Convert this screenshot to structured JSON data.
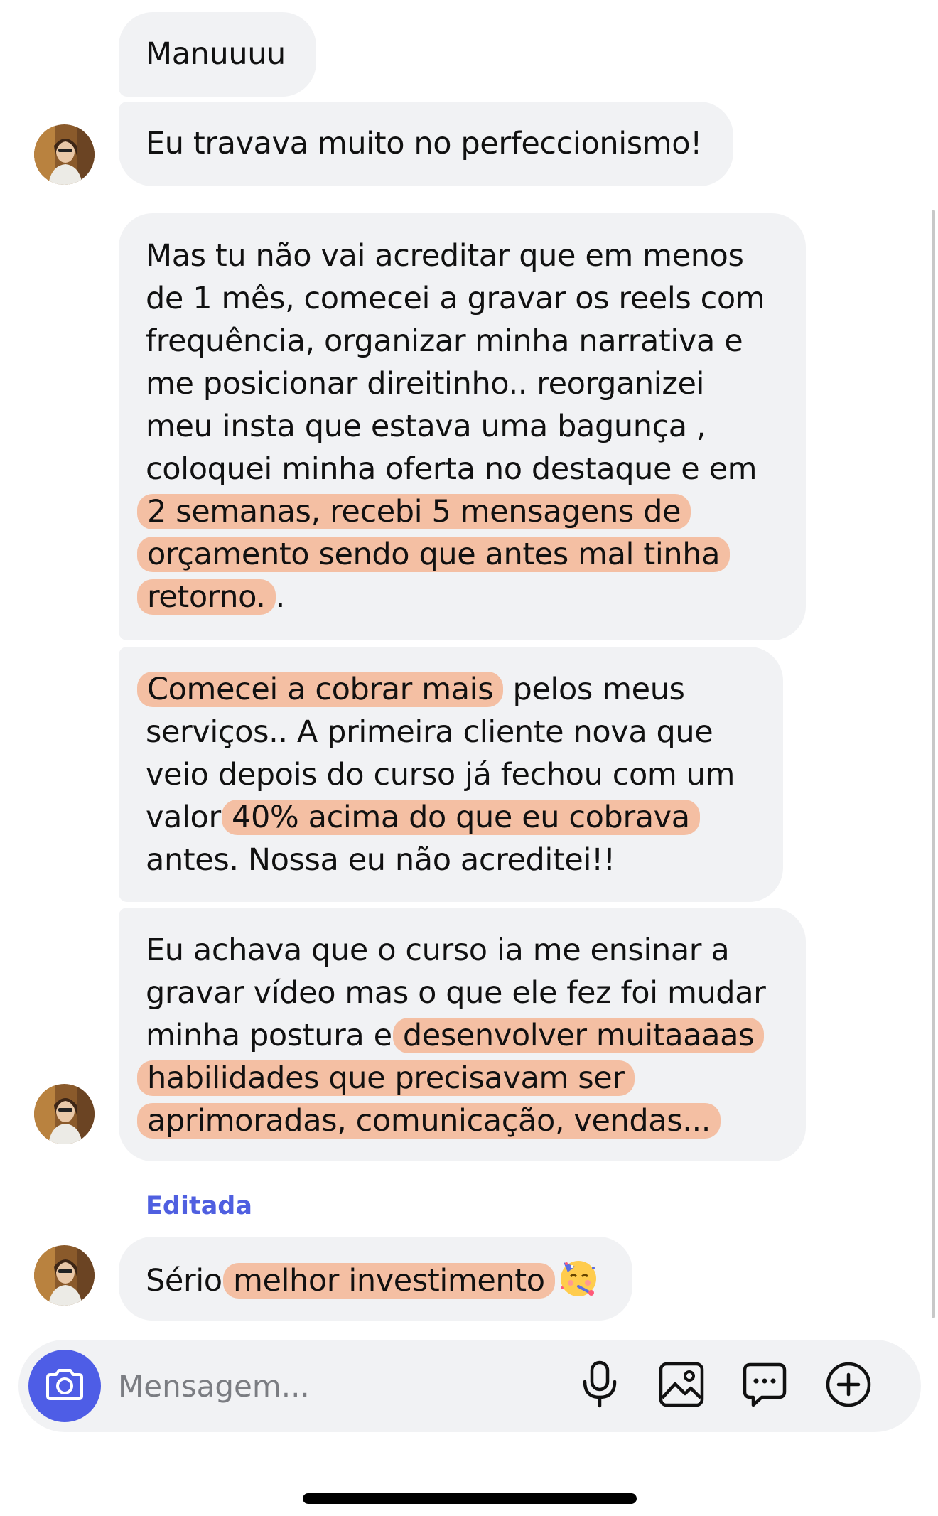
{
  "messages": [
    {
      "parts": [
        {
          "t": "Manuuuu"
        }
      ]
    },
    {
      "parts": [
        {
          "t": "Eu travava muito no perfeccionismo!"
        }
      ]
    },
    {
      "parts": [
        {
          "t": "Mas tu não vai acreditar que em menos de 1 mês, comecei a gravar os reels com frequência, organizar minha narrativa e me posicionar direitinho.. reorganizei meu insta que estava uma bagunça , coloquei minha oferta no destaque e em "
        },
        {
          "t": "2 semanas, recebi 5 mensagens de orçamento sendo que antes mal tinha retorno.",
          "hl": true
        },
        {
          "t": "."
        }
      ]
    },
    {
      "parts": [
        {
          "t": "Comecei a cobrar mais",
          "hl": true
        },
        {
          "t": " pelos meus serviços.. A primeira cliente nova que veio depois do curso já fechou com um valor "
        },
        {
          "t": "40% acima do que eu cobrava",
          "hl": true
        },
        {
          "t": " antes. Nossa eu não acreditei!!"
        }
      ]
    },
    {
      "parts": [
        {
          "t": "Eu achava que o curso ia me ensinar a gravar vídeo mas o que ele fez foi mudar minha postura e "
        },
        {
          "t": "desenvolver muitaaaas habilidades que precisavam ser aprimoradas, comunicação, vendas...",
          "hl": true
        }
      ]
    },
    {
      "parts": [
        {
          "t": "Sério "
        },
        {
          "t": "melhor investimento",
          "hl": true
        }
      ],
      "emoji": "partying-face-emoji"
    }
  ],
  "edited_label": "Editada",
  "composer": {
    "placeholder": "Mensagem...",
    "camera_icon": "camera-icon",
    "tools": [
      "microphone-icon",
      "image-icon",
      "sticker-icon",
      "add-icon"
    ]
  },
  "colors": {
    "bubble": "#f1f2f4",
    "highlight": "#f4bfa3",
    "accent": "#4e5de6",
    "edited": "#4f5fe0"
  }
}
